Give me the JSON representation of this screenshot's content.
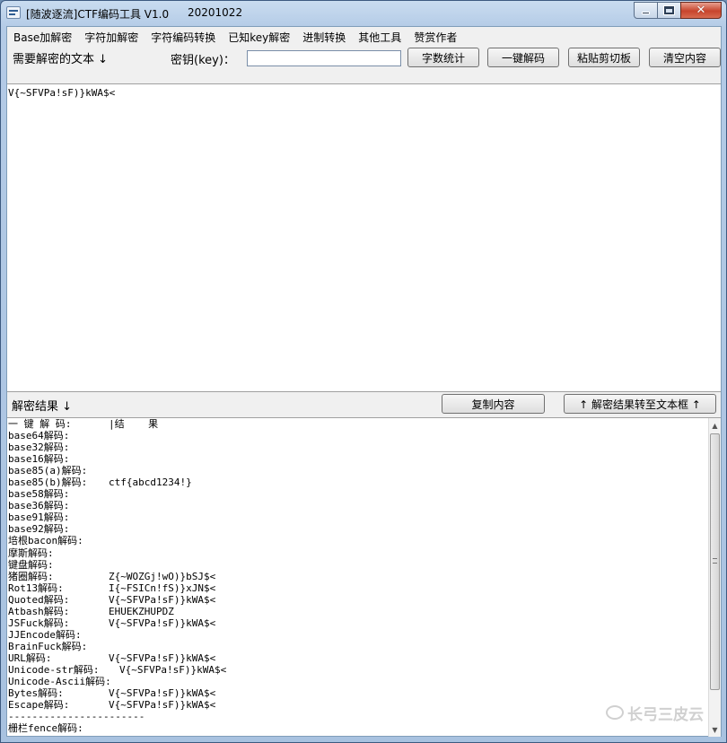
{
  "window": {
    "title": "[随波逐流]CTF编码工具 V1.0",
    "date": "20201022",
    "close_glyph": "✕"
  },
  "menu": [
    "Base加解密",
    "字符加解密",
    "字符编码转换",
    "已知key解密",
    "进制转换",
    "其他工具",
    "赞赏作者"
  ],
  "toolbar": {
    "need_label": "需要解密的文本 ↓",
    "key_label": "密钥(key)：",
    "key_value": "",
    "count_button": "字数统计",
    "decode_button": "一键解码",
    "paste_button": "粘贴剪切板",
    "clear_button": "清空内容"
  },
  "input_text": "V{~SFVPa!sF)}kWA$<",
  "result_bar": {
    "label": "解密结果 ↓",
    "copy_button": "复制内容",
    "transfer_button": "↑ 解密结果转至文本框 ↑"
  },
  "results": [
    {
      "k": "一 键 解 码:",
      "v": "|结    果"
    },
    {
      "k": "base64解码:",
      "v": ""
    },
    {
      "k": "base32解码:",
      "v": ""
    },
    {
      "k": "base16解码:",
      "v": ""
    },
    {
      "k": "base85(a)解码:",
      "v": ""
    },
    {
      "k": "base85(b)解码:",
      "v": "ctf{abcd1234!}"
    },
    {
      "k": "base58解码:",
      "v": ""
    },
    {
      "k": "base36解码:",
      "v": ""
    },
    {
      "k": "base91解码:",
      "v": ""
    },
    {
      "k": "base92解码:",
      "v": ""
    },
    {
      "k": "培根bacon解码:",
      "v": ""
    },
    {
      "k": "摩斯解码:",
      "v": ""
    },
    {
      "k": "键盘解码:",
      "v": ""
    },
    {
      "k": "猪圈解码:",
      "v": "Z{~WOZGj!wO)}bSJ$<"
    },
    {
      "k": "Rot13解码:",
      "v": "I{~FSICn!fS)}xJN$<"
    },
    {
      "k": "Quoted解码:",
      "v": "V{~SFVPa!sF)}kWA$<"
    },
    {
      "k": "Atbash解码:",
      "v": "EHUEKZHUPDZ"
    },
    {
      "k": "JSFuck解码:",
      "v": "V{~SFVPa!sF)}kWA$<"
    },
    {
      "k": "JJEncode解码:",
      "v": ""
    },
    {
      "k": "BrainFuck解码:",
      "v": ""
    },
    {
      "k": "URL解码:",
      "v": "V{~SFVPa!sF)}kWA$<"
    },
    {
      "k": "Unicode-str解码:",
      "v": "V{~SFVPa!sF)}kWA$<"
    },
    {
      "k": "Unicode-Ascii解码:",
      "v": ""
    },
    {
      "k": "Bytes解码:",
      "v": "V{~SFVPa!sF)}kWA$<"
    },
    {
      "k": "Escape解码:",
      "v": "V{~SFVPa!sF)}kWA$<"
    },
    {
      "k": "-----------------------",
      "v": ""
    },
    {
      "k": "栅栏fence解码:",
      "v": ""
    }
  ],
  "watermark": "长弓三皮云"
}
